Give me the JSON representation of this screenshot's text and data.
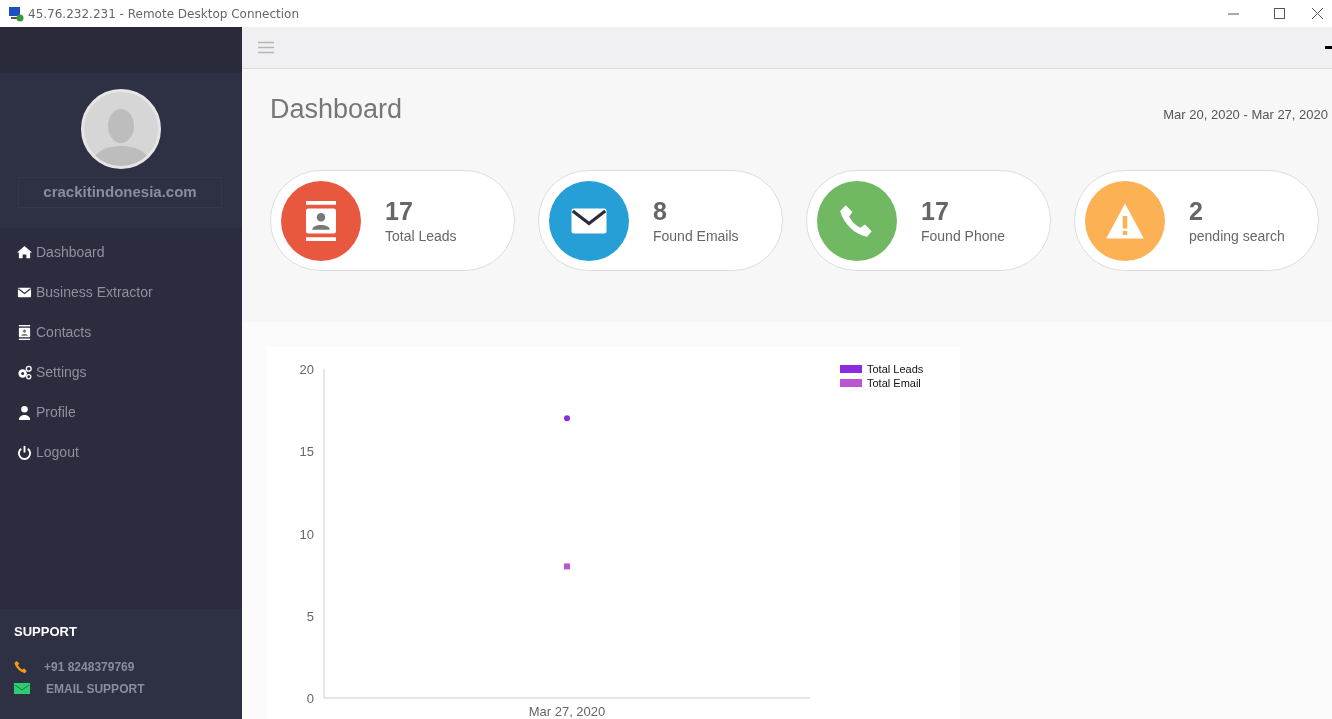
{
  "window": {
    "title": "45.76.232.231 - Remote Desktop Connection"
  },
  "sidebar": {
    "username": "crackitindonesia.com",
    "items": [
      {
        "label": "Dashboard"
      },
      {
        "label": "Business Extractor"
      },
      {
        "label": "Contacts"
      },
      {
        "label": "Settings"
      },
      {
        "label": "Profile"
      },
      {
        "label": "Logout"
      }
    ],
    "support": {
      "title": "SUPPORT",
      "phone": "+91 8248379769",
      "email": "EMAIL SUPPORT"
    }
  },
  "page": {
    "title": "Dashboard",
    "date_range": "Mar 20, 2020 - Mar 27, 2020"
  },
  "stats": [
    {
      "value": "17",
      "label": "Total Leads",
      "color": "#e8583f"
    },
    {
      "value": "8",
      "label": "Found Emails",
      "color": "#269fd6"
    },
    {
      "value": "17",
      "label": "Found Phone",
      "color": "#70b962"
    },
    {
      "value": "2",
      "label": "pending search",
      "color": "#fdb155"
    }
  ],
  "chart": {
    "chart_data": {
      "type": "scatter",
      "categories": [
        "Mar 27, 2020"
      ],
      "series": [
        {
          "name": "Total Leads",
          "color": "#8a2be2",
          "values": [
            17
          ]
        },
        {
          "name": "Total Email",
          "color": "#ba55d3",
          "values": [
            8
          ]
        }
      ],
      "ylim": [
        0,
        20
      ],
      "yticks": [
        0,
        5,
        10,
        15,
        20
      ],
      "legend": "top-right"
    }
  }
}
